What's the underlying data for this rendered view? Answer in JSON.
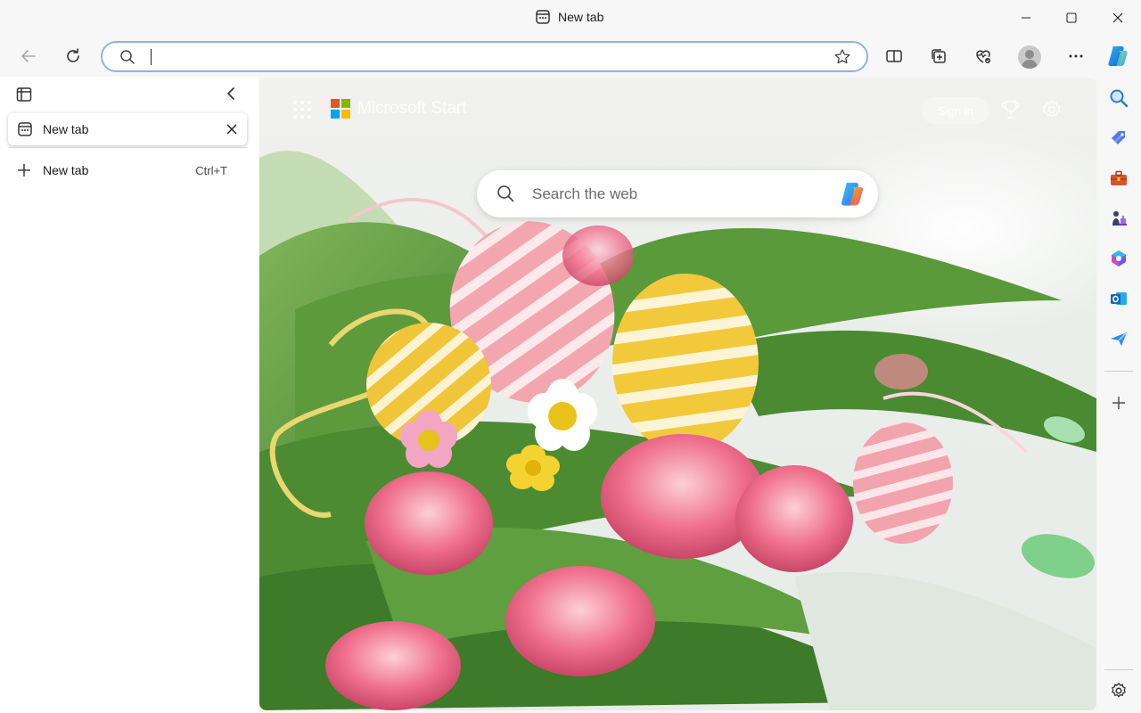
{
  "window": {
    "title": "New tab",
    "controls": [
      "minimize",
      "maximize",
      "close"
    ]
  },
  "toolbar": {
    "address_placeholder": "",
    "icons": [
      "back-icon",
      "refresh-icon",
      "search-icon",
      "favorite-star-icon",
      "split-screen-icon",
      "collections-icon",
      "browser-essentials-icon",
      "profile-avatar",
      "more-icon",
      "copilot-icon"
    ]
  },
  "vertical_tabs": {
    "active_tab": "New tab",
    "new_tab_label": "New tab",
    "new_tab_shortcut": "Ctrl+T"
  },
  "new_tab_page": {
    "brand": "Microsoft Start",
    "sign_in": "Sign in",
    "search_placeholder": "Search the web"
  },
  "sidebar": {
    "apps": [
      "search-icon",
      "shopping-icon",
      "tools-icon",
      "games-icon",
      "microsoft-365-icon",
      "outlook-icon",
      "drop-icon"
    ],
    "add_label": "+",
    "settings": "settings-icon"
  },
  "colors": {
    "address_border": "#8fb3e2",
    "ms_red": "#f25022",
    "ms_green": "#7fba00",
    "ms_blue": "#00a4ef",
    "ms_yellow": "#ffb900"
  }
}
